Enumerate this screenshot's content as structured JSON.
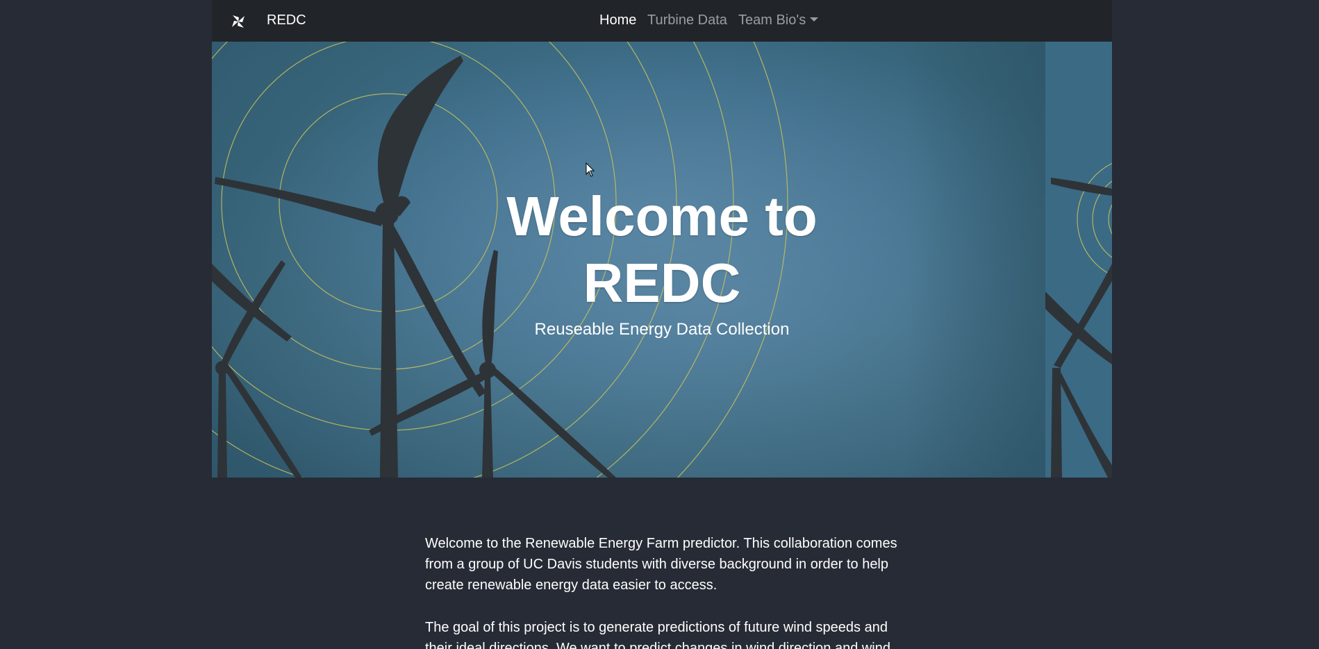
{
  "navbar": {
    "brand": "REDC",
    "brand_icon": "pinwheel-icon",
    "links": {
      "home": "Home",
      "turbine_data": "Turbine Data",
      "team_bios": "Team Bio's"
    }
  },
  "hero": {
    "title_line1": "Welcome to",
    "title_line2": "REDC",
    "subtitle": "Reuseable Energy Data Collection"
  },
  "content": {
    "paragraph1": "Welcome to the Renewable Energy Farm predictor. This collaboration comes from a group of UC Davis students with diverse background in order to help create renewable energy data easier to access.",
    "paragraph2": "The goal of this project is to generate predictions of future wind speeds and their ideal directions. We want to predict changes in wind direction and wind"
  },
  "colors": {
    "page_bg": "#262b35",
    "navbar_bg": "#212529",
    "ring": "#c9c25a",
    "turbine": "#2e3338"
  }
}
